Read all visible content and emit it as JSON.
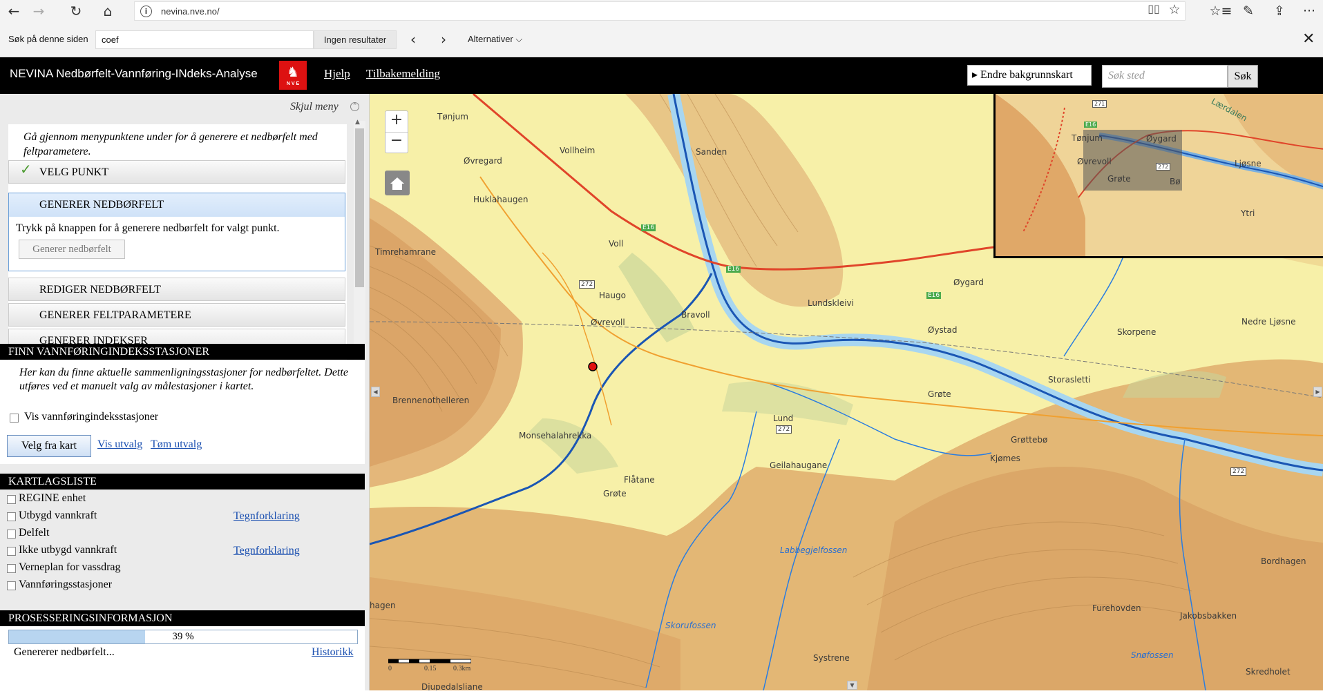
{
  "browser": {
    "url": "nevina.nve.no/",
    "back_icon": "←",
    "forward_icon": "→",
    "refresh_icon": "↻",
    "home_icon": "⌂",
    "reading_icon": "📖",
    "star_icon": "☆",
    "favorites_icon": "≡",
    "notes_icon": "✎",
    "share_icon": "⇪",
    "more_icon": "···"
  },
  "find_bar": {
    "label": "Søk på denne siden",
    "query": "coef",
    "results": "Ingen resultater",
    "prev_icon": "‹",
    "next_icon": "›",
    "options": "Alternativer ⌵",
    "close_icon": "✕"
  },
  "header": {
    "title": "NEVINA Nedbørfelt-Vannføring-INdeks-Analyse",
    "logo_text": "N V E",
    "links": [
      "Hjelp",
      "Tilbakemelding"
    ],
    "basemap_button": "▸ Endre bakgrunnskart",
    "search_placeholder": "Søk sted",
    "search_button": "Søk"
  },
  "panel": {
    "hide_menu": "Skjul meny",
    "intro": "Gå gjennom menypunktene under for å generere et nedbørfelt med feltparametere.",
    "menu": [
      {
        "label": "VELG PUNKT",
        "done": true
      },
      {
        "label": "GENERER NEDBØRFELT",
        "active": true
      },
      {
        "label": "REDIGER NEDBØRFELT"
      },
      {
        "label": "GENERER FELTPARAMETERE"
      },
      {
        "label": "GENERER INDEKSER"
      }
    ],
    "active_description": "Trykk på knappen for å generere nedbørfelt for valgt punkt.",
    "generate_button": "Generer nedbørfelt"
  },
  "stations": {
    "header": "FINN VANNFØRINGINDEKSSTASJONER",
    "description": "Her kan du finne aktuelle sammenligningsstasjoner for nedbørfeltet. Dette utføres ved et manuelt valg av målestasjoner i kartet.",
    "checkbox_label": "Vis vannføringindeksstasjoner",
    "select_button": "Velg fra kart",
    "show_selection": "Vis utvalg",
    "clear_selection": "Tøm utvalg"
  },
  "layers": {
    "header": "KARTLAGSLISTE",
    "items": [
      {
        "label": "REGINE enhet",
        "legend": ""
      },
      {
        "label": "Utbygd vannkraft",
        "legend": "Tegnforklaring"
      },
      {
        "label": "Delfelt",
        "legend": ""
      },
      {
        "label": "Ikke utbygd vannkraft",
        "legend": "Tegnforklaring"
      },
      {
        "label": "Verneplan for vassdrag",
        "legend": ""
      },
      {
        "label": "Vannføringsstasjoner",
        "legend": ""
      }
    ]
  },
  "processing": {
    "header": "PROSESSERINGSINFORMASJON",
    "progress": 39,
    "progress_label": "39 %",
    "status": "Genererer nedbørfelt...",
    "history": "Historikk"
  },
  "map": {
    "zoom_in": "+",
    "zoom_out": "−",
    "scale_labels": [
      "0",
      "0.15",
      "0.3km"
    ],
    "place_labels": [
      "Tønjum",
      "Vollheim",
      "Øvregard",
      "Huklahaugen",
      "Sanden",
      "Voll",
      "Timrehamrane",
      "Haugo",
      "Øvrevoll",
      "Bravoll",
      "Lundskleivi",
      "Øygard",
      "Øystad",
      "Skorpene",
      "Nedre Ljøsne",
      "Storasletti",
      "Grøte",
      "Brennenothelleren",
      "Lund",
      "Grøttebø",
      "Kjømes",
      "Monsehalahrekka",
      "Flåtane",
      "Grøte",
      "Geilahaugane",
      "Labbegjelfossen",
      "Bordhagen",
      "Furehovden",
      "Jakobsbakken",
      "Skorufossen",
      "Systrene",
      "Snøfossen",
      "Skredholet",
      "Djupedalsliane",
      "hagen"
    ],
    "overview_labels": [
      "Tønjum",
      "Øvrevoll",
      "Grøte",
      "Øygard",
      "Ljøsne",
      "Bø",
      "Ytri",
      "Lærdalen"
    ],
    "road_labels": [
      "E16",
      "E16",
      "E16",
      "272",
      "272",
      "272",
      "271",
      "E16",
      "272"
    ]
  }
}
